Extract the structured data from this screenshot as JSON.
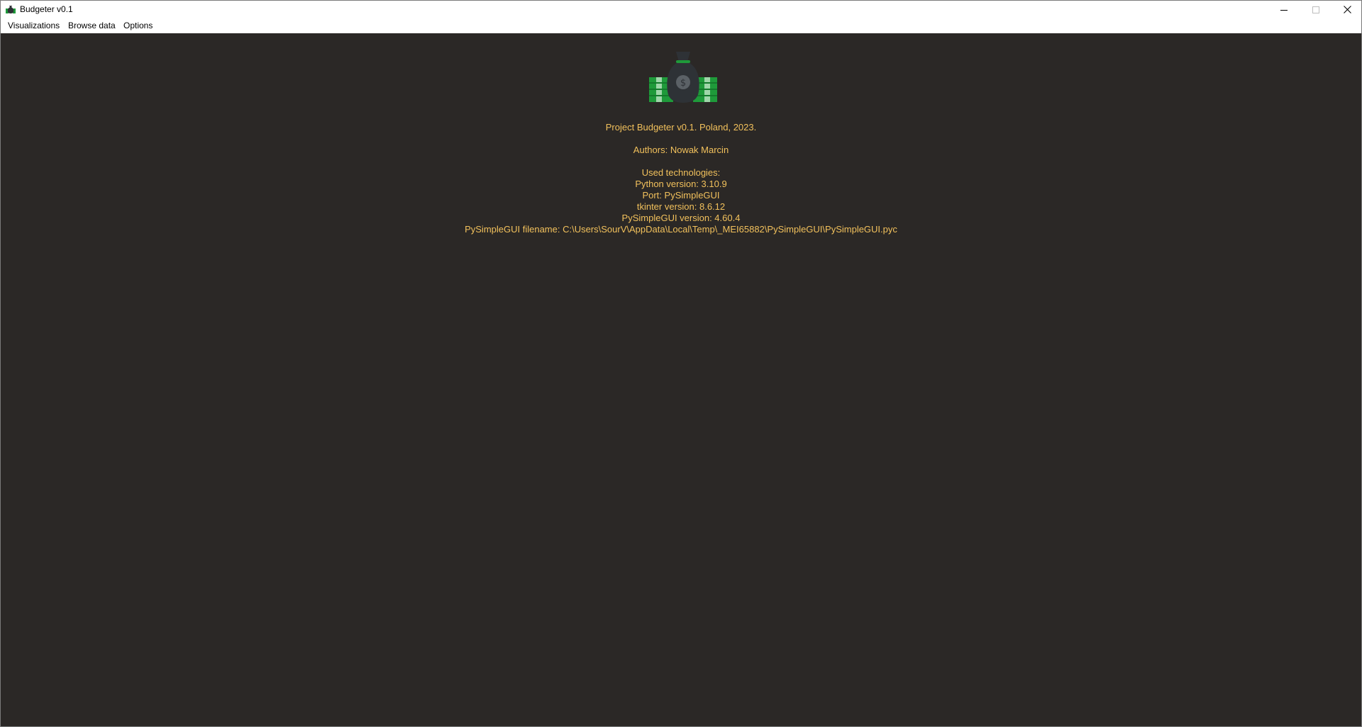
{
  "window": {
    "title": "Budgeter v0.1",
    "controls": {
      "minimize": "minimize-icon",
      "maximize": "maximize-icon",
      "close": "close-icon"
    }
  },
  "menu": {
    "items": [
      "Visualizations",
      "Browse data",
      "Options"
    ]
  },
  "about": {
    "logo_icon": "money-bag-icon",
    "project": "Project Budgeter v0.1. Poland, 2023.",
    "authors": "Authors: Nowak Marcin",
    "used_technologies": "Used technologies:",
    "python_version": "Python version: 3.10.9",
    "port": "Port: PySimpleGUI",
    "tkinter_version": "tkinter version: 8.6.12",
    "psg_version": "PySimpleGUI version: 4.60.4",
    "psg_filename": "PySimpleGUI filename: C:\\Users\\SourV\\AppData\\Local\\Temp\\_MEI65882\\PySimpleGUI\\PySimpleGUI.pyc"
  },
  "colors": {
    "background": "#2b2826",
    "text": "#f2c15c",
    "money_green": "#1f9a3a",
    "bag": "#2e3236"
  }
}
